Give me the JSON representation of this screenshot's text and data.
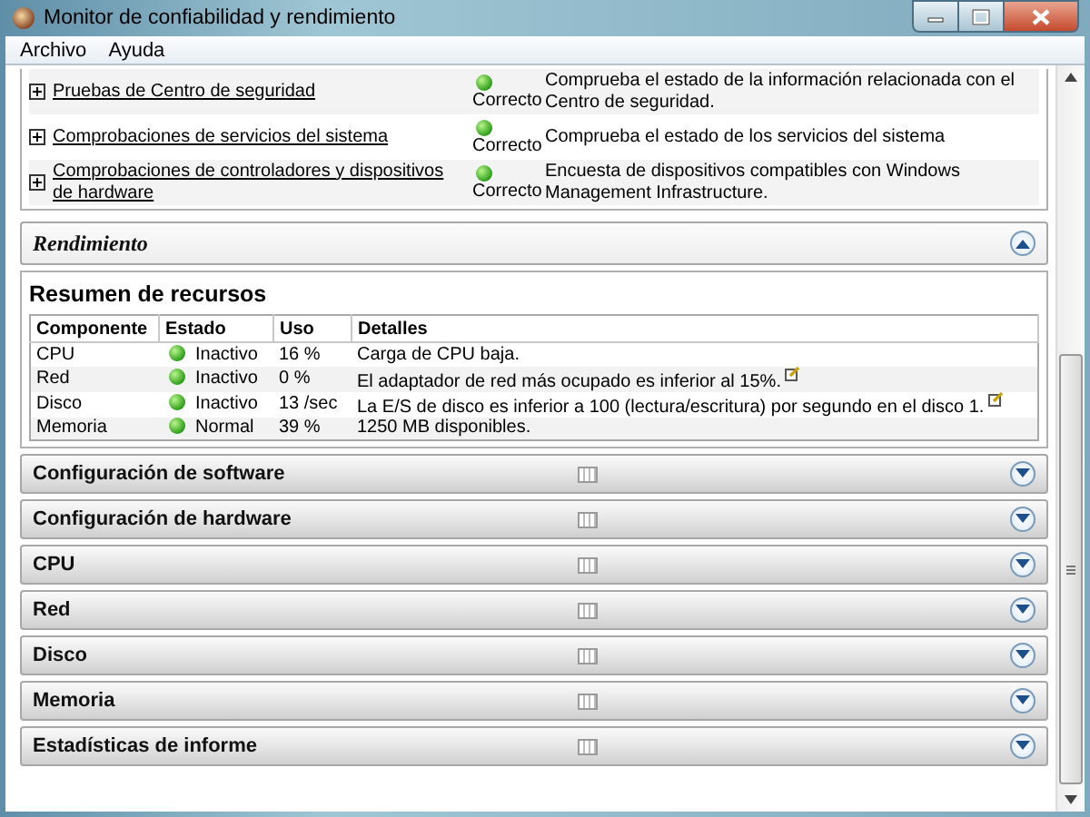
{
  "window": {
    "title": "Monitor de confiabilidad y rendimiento"
  },
  "menu": [
    {
      "label": "Archivo"
    },
    {
      "label": "Ayuda"
    }
  ],
  "checks": [
    {
      "name": "Pruebas de Centro de seguridad",
      "expanded": false,
      "status": "Correcto",
      "description": "Comprueba el estado de la información relacionada con el Centro de seguridad."
    },
    {
      "name": "Comprobaciones de servicios del sistema",
      "expanded": false,
      "status": "Correcto",
      "description": "Comprueba el estado de los servicios del sistema"
    },
    {
      "name": "Comprobaciones de controladores y dispositivos de hardware",
      "expanded": false,
      "status": "Correcto",
      "description": "Encuesta de dispositivos compatibles con Windows Management Infrastructure."
    }
  ],
  "performance": {
    "title": "Rendimiento",
    "expanded": true,
    "summary_title": "Resumen de recursos",
    "columns": [
      "Componente",
      "Estado",
      "Uso",
      "Detalles"
    ],
    "rows": [
      {
        "component": "CPU",
        "status": "Inactivo",
        "usage": "16 %",
        "details": "Carga de CPU baja.",
        "note": false
      },
      {
        "component": "Red",
        "status": "Inactivo",
        "usage": "0 %",
        "details": "El adaptador de red más ocupado es inferior al 15%.",
        "note": true
      },
      {
        "component": "Disco",
        "status": "Inactivo",
        "usage": "13 /sec",
        "details": "La E/S de disco es inferior a 100 (lectura/escritura) por segundo en el disco 1.",
        "note": true
      },
      {
        "component": "Memoria",
        "status": "Normal",
        "usage": "39 %",
        "details": "1250 MB disponibles.",
        "note": false
      }
    ]
  },
  "sections": [
    {
      "title": "Configuración de software",
      "expanded": false
    },
    {
      "title": "Configuración de hardware",
      "expanded": false
    },
    {
      "title": "CPU",
      "expanded": false
    },
    {
      "title": "Red",
      "expanded": false
    },
    {
      "title": "Disco",
      "expanded": false
    },
    {
      "title": "Memoria",
      "expanded": false
    },
    {
      "title": "Estadísticas de informe",
      "expanded": false
    }
  ]
}
